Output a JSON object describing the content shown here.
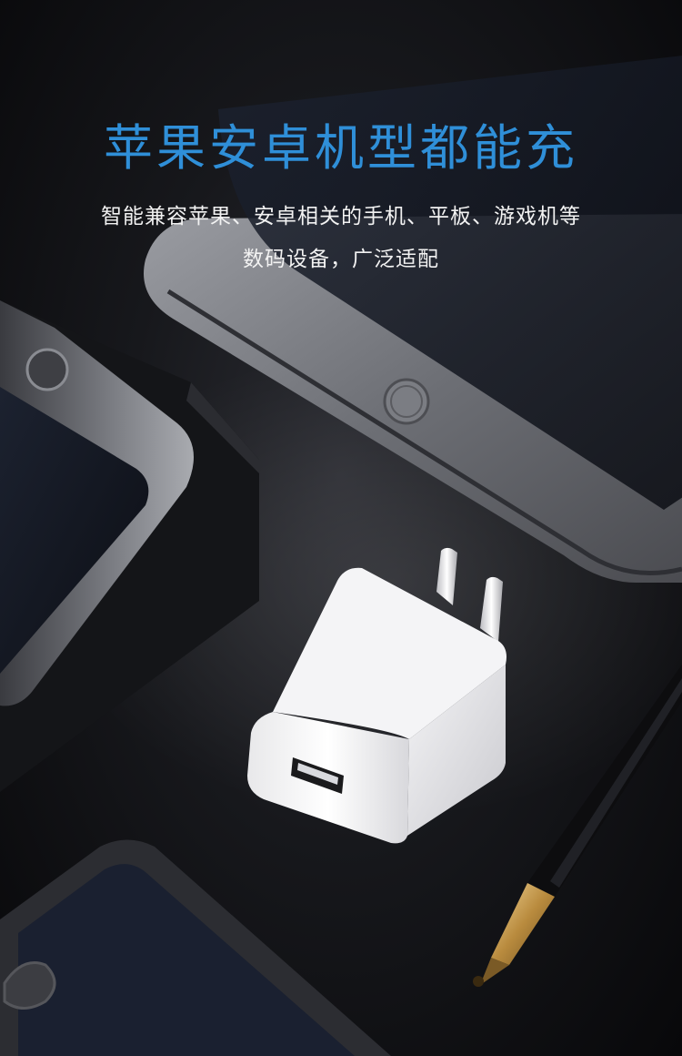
{
  "headline": "苹果安卓机型都能充",
  "description": {
    "line1": "智能兼容苹果、安卓相关的手机、平板、游戏机等",
    "line2": "数码设备，广泛适配"
  },
  "colors": {
    "headline": "#2f8fd8",
    "text": "#f2f2f2",
    "background": "#0a0a0c"
  }
}
